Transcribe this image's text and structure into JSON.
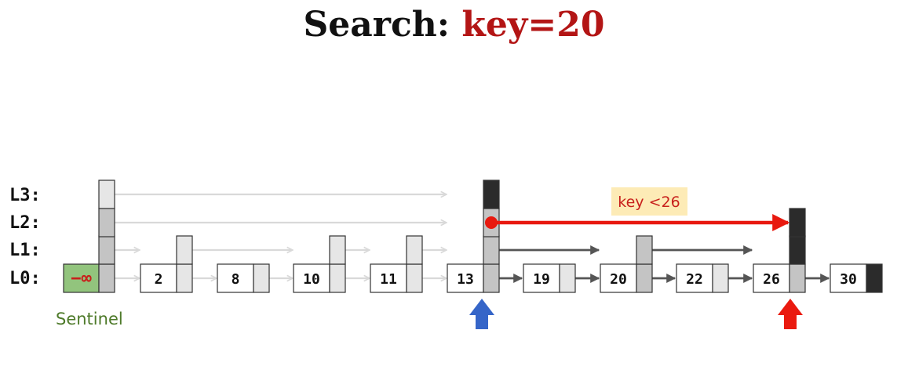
{
  "title": {
    "prefix": "Search:",
    "key": "key=20"
  },
  "levels": [
    "L3:",
    "L2:",
    "L1:",
    "L0:"
  ],
  "sentinel": {
    "symbol": "−∞",
    "label": "Sentinel",
    "height": 4
  },
  "nodes": [
    {
      "key": "2",
      "height": 2
    },
    {
      "key": "8",
      "height": 1
    },
    {
      "key": "10",
      "height": 2
    },
    {
      "key": "11",
      "height": 2
    },
    {
      "key": "13",
      "height": 4
    },
    {
      "key": "19",
      "height": 1
    },
    {
      "key": "20",
      "height": 2
    },
    {
      "key": "22",
      "height": 1
    },
    {
      "key": "26",
      "height": 3
    },
    {
      "key": "30",
      "height": 1
    }
  ],
  "annotation": "key <26",
  "colors": {
    "sentinel_fill": "#92c47d",
    "sentinel_text": "#4e7a2a",
    "visited_pointer": "#c4c4c4",
    "unvisited_pointer": "#e6e6e6",
    "null_pointer": "#2b2b2b",
    "active_arrow": "#555555",
    "faded_arrow": "#d9d9d9",
    "search_arrow": "#e8190f",
    "annotation_bg": "#fdebb6",
    "annotation_text": "#c8201c",
    "cursor_blue": "#3565c8",
    "cursor_red": "#ea1a0f"
  }
}
